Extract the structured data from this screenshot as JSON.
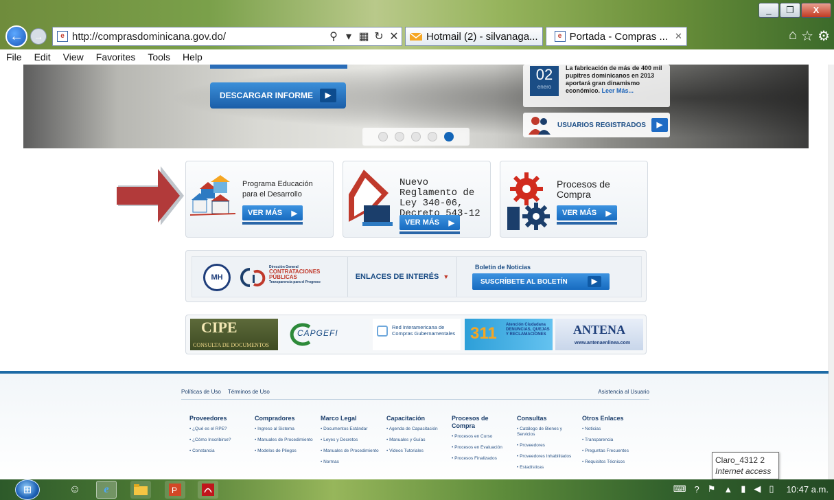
{
  "browser": {
    "url": "http://comprasdominicana.gov.do/",
    "tabs": [
      {
        "label": "Hotmail (2) - silvanaga...",
        "active": false
      },
      {
        "label": "Portada - Compras ...",
        "active": true
      }
    ],
    "menu": [
      "File",
      "Edit",
      "View",
      "Favorites",
      "Tools",
      "Help"
    ],
    "window_buttons": {
      "minimize": "_",
      "restore": "❐",
      "close": "X"
    },
    "nav_icons": {
      "back": "back-icon",
      "forward": "forward-icon",
      "home": "home-icon",
      "favorites": "star-icon",
      "settings": "gear-icon"
    }
  },
  "hero": {
    "download_label": "DESCARGAR INFORME",
    "news_day": "02",
    "news_month": "enero",
    "news_text": "La fabricación de más de 400 mil pupitres dominicanos en 2013 aportará gran dinamismo económico.",
    "news_more": "Leer Más...",
    "users_label": "USUARIOS REGISTRADOS",
    "carousel_active_index": 5
  },
  "promos": [
    {
      "title": "Programa Educación para el Desarrollo",
      "button": "VER MÁS"
    },
    {
      "title": "Nuevo Reglamento de Ley 340-06, Decreto 543-12",
      "button": "VER MÁS"
    },
    {
      "title": "Procesos de Compra",
      "button": "VER MÁS"
    }
  ],
  "links_row": {
    "seal_text": "MH",
    "dgcp_lines": [
      "Dirección General",
      "CONTRATACIONES",
      "PÚBLICAS",
      "Transparencia para el Progreso"
    ],
    "enlaces_label": "ENLACES DE INTERÉS",
    "boletin_title": "Boletín de Noticias",
    "subscribe_label": "SUSCRÍBETE AL BOLETÍN"
  },
  "logos": {
    "cipe": {
      "big": "CIPE",
      "sub": "CONSULTA DE DOCUMENTOS"
    },
    "capgefi": "CAPGEFI",
    "ricg": "Red Interamericana de Compras Gubernamentales",
    "l311": {
      "num": "311",
      "text": "Atención Ciudadana DENUNCIAS, QUEJAS Y RECLAMACIONES"
    },
    "antena": {
      "big": "ANTENA",
      "url": "www.antenaenlinea.com"
    }
  },
  "footer": {
    "policies": "Políticas de Uso",
    "terms": "Términos de Uso",
    "assist": "Asistencia al Usuario",
    "columns": [
      {
        "title": "Proveedores",
        "items": [
          "• ¿Qué es el RPE?",
          "• ¿Cómo Inscribirse?",
          "• Constancia"
        ]
      },
      {
        "title": "Compradores",
        "items": [
          "• Ingreso al Sistema",
          "• Manuales de Procedimiento",
          "• Modelos de Pliegos"
        ]
      },
      {
        "title": "Marco Legal",
        "items": [
          "• Documentos Estándar",
          "• Leyes y Decretos",
          "• Manuales de Procedimiento",
          "• Normas"
        ]
      },
      {
        "title": "Capacitación",
        "items": [
          "• Agenda de Capacitación",
          "• Manuales y Guías",
          "• Videos Tutoriales"
        ]
      },
      {
        "title": "Procesos de Compra",
        "items": [
          "• Procesos en Curso",
          "• Procesos en Evaluación",
          "• Procesos Finalizados"
        ]
      },
      {
        "title": "Consultas",
        "items": [
          "• Catálogo de Bienes y Servicios",
          "• Proveedores",
          "• Proveedores Inhabilitados",
          "• Estadísticas"
        ]
      },
      {
        "title": "Otros Enlaces",
        "items": [
          "• Noticias",
          "• Transparencia",
          "• Preguntas Frecuentes",
          "• Requisitos Técnicos"
        ]
      }
    ]
  },
  "tooltip": {
    "network": "Claro_4312  2",
    "status": "Internet access"
  },
  "taskbar": {
    "clock": "10:47 a.m."
  }
}
